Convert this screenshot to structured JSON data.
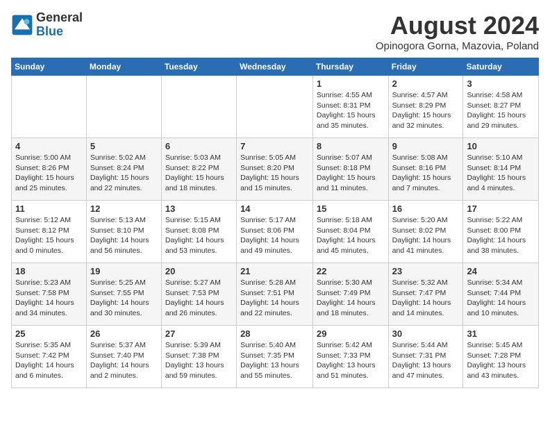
{
  "logo": {
    "general": "General",
    "blue": "Blue"
  },
  "title": {
    "month_year": "August 2024",
    "location": "Opinogora Gorna, Mazovia, Poland"
  },
  "headers": [
    "Sunday",
    "Monday",
    "Tuesday",
    "Wednesday",
    "Thursday",
    "Friday",
    "Saturday"
  ],
  "weeks": [
    [
      {
        "day": "",
        "info": ""
      },
      {
        "day": "",
        "info": ""
      },
      {
        "day": "",
        "info": ""
      },
      {
        "day": "",
        "info": ""
      },
      {
        "day": "1",
        "info": "Sunrise: 4:55 AM\nSunset: 8:31 PM\nDaylight: 15 hours\nand 35 minutes."
      },
      {
        "day": "2",
        "info": "Sunrise: 4:57 AM\nSunset: 8:29 PM\nDaylight: 15 hours\nand 32 minutes."
      },
      {
        "day": "3",
        "info": "Sunrise: 4:58 AM\nSunset: 8:27 PM\nDaylight: 15 hours\nand 29 minutes."
      }
    ],
    [
      {
        "day": "4",
        "info": "Sunrise: 5:00 AM\nSunset: 8:26 PM\nDaylight: 15 hours\nand 25 minutes."
      },
      {
        "day": "5",
        "info": "Sunrise: 5:02 AM\nSunset: 8:24 PM\nDaylight: 15 hours\nand 22 minutes."
      },
      {
        "day": "6",
        "info": "Sunrise: 5:03 AM\nSunset: 8:22 PM\nDaylight: 15 hours\nand 18 minutes."
      },
      {
        "day": "7",
        "info": "Sunrise: 5:05 AM\nSunset: 8:20 PM\nDaylight: 15 hours\nand 15 minutes."
      },
      {
        "day": "8",
        "info": "Sunrise: 5:07 AM\nSunset: 8:18 PM\nDaylight: 15 hours\nand 11 minutes."
      },
      {
        "day": "9",
        "info": "Sunrise: 5:08 AM\nSunset: 8:16 PM\nDaylight: 15 hours\nand 7 minutes."
      },
      {
        "day": "10",
        "info": "Sunrise: 5:10 AM\nSunset: 8:14 PM\nDaylight: 15 hours\nand 4 minutes."
      }
    ],
    [
      {
        "day": "11",
        "info": "Sunrise: 5:12 AM\nSunset: 8:12 PM\nDaylight: 15 hours\nand 0 minutes."
      },
      {
        "day": "12",
        "info": "Sunrise: 5:13 AM\nSunset: 8:10 PM\nDaylight: 14 hours\nand 56 minutes."
      },
      {
        "day": "13",
        "info": "Sunrise: 5:15 AM\nSunset: 8:08 PM\nDaylight: 14 hours\nand 53 minutes."
      },
      {
        "day": "14",
        "info": "Sunrise: 5:17 AM\nSunset: 8:06 PM\nDaylight: 14 hours\nand 49 minutes."
      },
      {
        "day": "15",
        "info": "Sunrise: 5:18 AM\nSunset: 8:04 PM\nDaylight: 14 hours\nand 45 minutes."
      },
      {
        "day": "16",
        "info": "Sunrise: 5:20 AM\nSunset: 8:02 PM\nDaylight: 14 hours\nand 41 minutes."
      },
      {
        "day": "17",
        "info": "Sunrise: 5:22 AM\nSunset: 8:00 PM\nDaylight: 14 hours\nand 38 minutes."
      }
    ],
    [
      {
        "day": "18",
        "info": "Sunrise: 5:23 AM\nSunset: 7:58 PM\nDaylight: 14 hours\nand 34 minutes."
      },
      {
        "day": "19",
        "info": "Sunrise: 5:25 AM\nSunset: 7:55 PM\nDaylight: 14 hours\nand 30 minutes."
      },
      {
        "day": "20",
        "info": "Sunrise: 5:27 AM\nSunset: 7:53 PM\nDaylight: 14 hours\nand 26 minutes."
      },
      {
        "day": "21",
        "info": "Sunrise: 5:28 AM\nSunset: 7:51 PM\nDaylight: 14 hours\nand 22 minutes."
      },
      {
        "day": "22",
        "info": "Sunrise: 5:30 AM\nSunset: 7:49 PM\nDaylight: 14 hours\nand 18 minutes."
      },
      {
        "day": "23",
        "info": "Sunrise: 5:32 AM\nSunset: 7:47 PM\nDaylight: 14 hours\nand 14 minutes."
      },
      {
        "day": "24",
        "info": "Sunrise: 5:34 AM\nSunset: 7:44 PM\nDaylight: 14 hours\nand 10 minutes."
      }
    ],
    [
      {
        "day": "25",
        "info": "Sunrise: 5:35 AM\nSunset: 7:42 PM\nDaylight: 14 hours\nand 6 minutes."
      },
      {
        "day": "26",
        "info": "Sunrise: 5:37 AM\nSunset: 7:40 PM\nDaylight: 14 hours\nand 2 minutes."
      },
      {
        "day": "27",
        "info": "Sunrise: 5:39 AM\nSunset: 7:38 PM\nDaylight: 13 hours\nand 59 minutes."
      },
      {
        "day": "28",
        "info": "Sunrise: 5:40 AM\nSunset: 7:35 PM\nDaylight: 13 hours\nand 55 minutes."
      },
      {
        "day": "29",
        "info": "Sunrise: 5:42 AM\nSunset: 7:33 PM\nDaylight: 13 hours\nand 51 minutes."
      },
      {
        "day": "30",
        "info": "Sunrise: 5:44 AM\nSunset: 7:31 PM\nDaylight: 13 hours\nand 47 minutes."
      },
      {
        "day": "31",
        "info": "Sunrise: 5:45 AM\nSunset: 7:28 PM\nDaylight: 13 hours\nand 43 minutes."
      }
    ]
  ]
}
